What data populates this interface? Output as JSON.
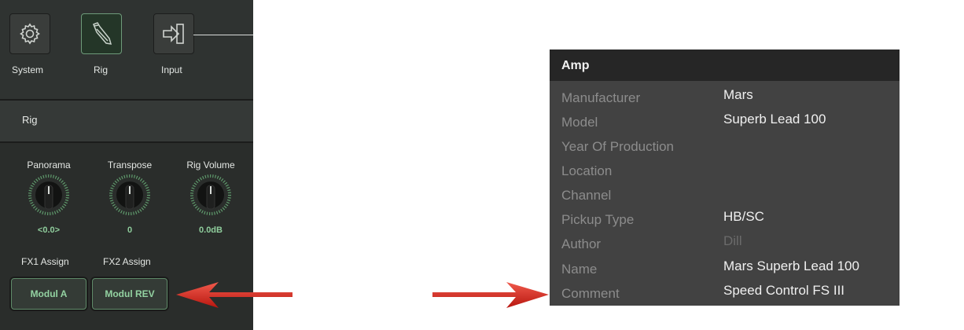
{
  "rig_panel": {
    "toolbar": [
      {
        "label": "System",
        "icon": "gear-icon"
      },
      {
        "label": "Rig",
        "icon": "guitar-neck-icon",
        "active": true
      },
      {
        "label": "Input",
        "icon": "input-arrow-icon"
      }
    ],
    "section_title": "Rig",
    "knobs": [
      {
        "label": "Panorama",
        "value": "<0.0>"
      },
      {
        "label": "Transpose",
        "value": "0"
      },
      {
        "label": "Rig Volume",
        "value": "0.0dB"
      }
    ],
    "fx": [
      {
        "label": "FX1 Assign",
        "button": "Modul A"
      },
      {
        "label": "FX2 Assign",
        "button": "Modul REV"
      }
    ]
  },
  "amp_panel": {
    "title": "Amp",
    "rows": [
      {
        "key": "Manufacturer",
        "value": "Mars"
      },
      {
        "key": "Model",
        "value": "Superb Lead 100"
      },
      {
        "key": "Year Of Production",
        "value": ""
      },
      {
        "key": "Location",
        "value": ""
      },
      {
        "key": "Channel",
        "value": ""
      },
      {
        "key": "Pickup Type",
        "value": "HB/SC"
      },
      {
        "key": "Author",
        "value": "Dill"
      },
      {
        "key": "Name",
        "value": "Mars Superb Lead 100"
      },
      {
        "key": "Comment",
        "value": "Speed Control FS III"
      }
    ]
  },
  "colors": {
    "accent_green": "#8fcd9c",
    "arrow_red": "#d62a1e",
    "panel_dark": "#2a2d2b",
    "amp_bg": "#424242"
  }
}
